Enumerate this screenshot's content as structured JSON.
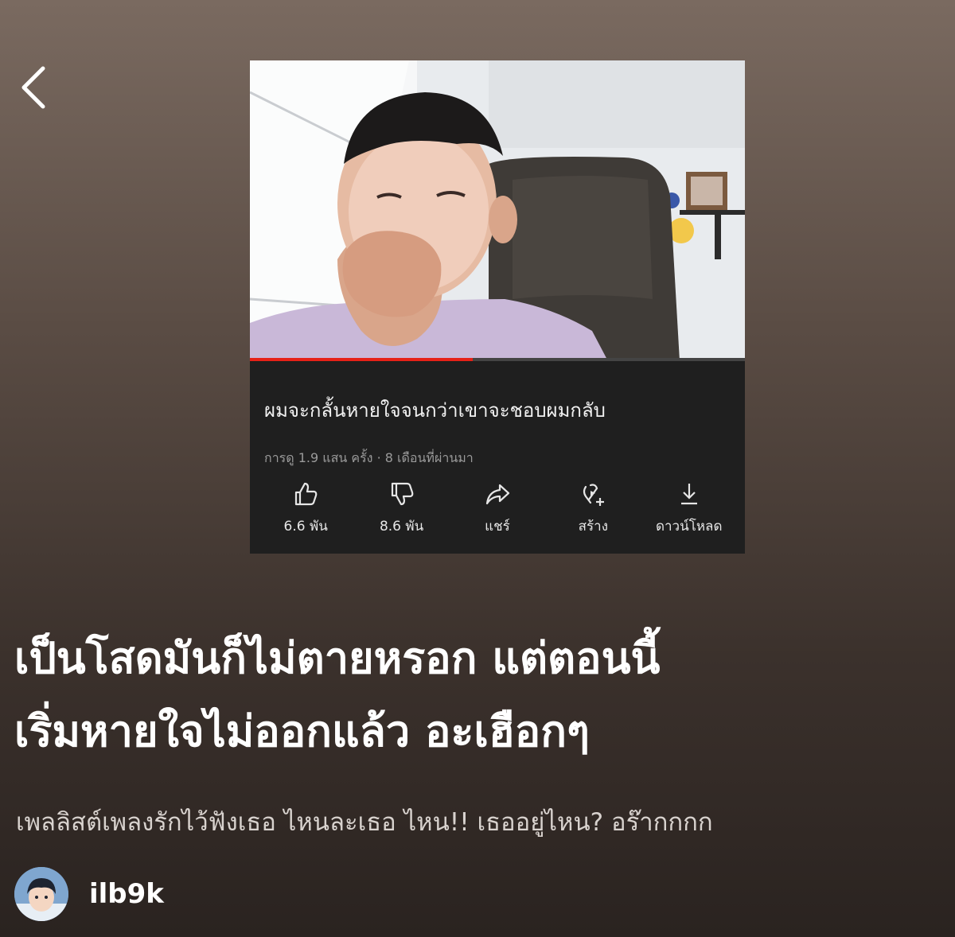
{
  "navigation": {
    "back_icon": "chevron-left-icon"
  },
  "video_card": {
    "title": "ผมจะกลั้นหายใจจนกว่าเขาจะชอบผมกลับ",
    "meta": "การดู 1.9 แสน ครั้ง · 8 เดือนที่ผ่านมา",
    "progress_fraction": 0.45,
    "actions": [
      {
        "icon": "thumbs-up-icon",
        "label": "6.6 พัน"
      },
      {
        "icon": "thumbs-down-icon",
        "label": "8.6 พัน"
      },
      {
        "icon": "share-icon",
        "label": "แชร์"
      },
      {
        "icon": "create-icon",
        "label": "สร้าง"
      },
      {
        "icon": "download-icon",
        "label": "ดาวน์โหลด"
      }
    ]
  },
  "post": {
    "headline_line1": "เป็นโสดมันก็ไม่ตายหรอก แต่ตอนนี้",
    "headline_line2": "เริ่มหายใจไม่ออกแล้ว อะเฮือกๆ",
    "subtext": "เพลลิสต์เพลงรักไว้ฟังเธอ ไหนละเธอ ไหน!! เธออยู่ไหน? อร๊ากกกก"
  },
  "user": {
    "username": "ilb9k"
  },
  "colors": {
    "accent_red": "#e62117",
    "card_bg": "#1f1f1f"
  }
}
